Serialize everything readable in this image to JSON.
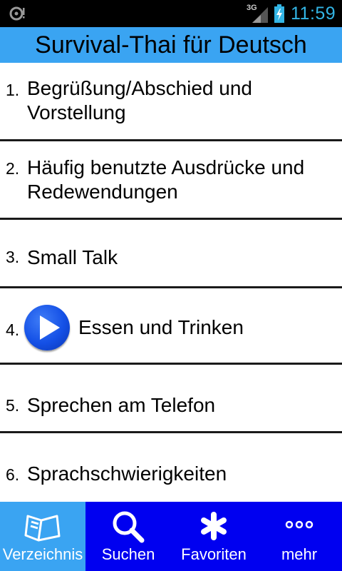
{
  "status_bar": {
    "network": "3G",
    "time": "11:59",
    "accent_color": "#33b5e5"
  },
  "app": {
    "title": "Survival-Thai für Deutsch",
    "title_bar_color": "#3aa4f2"
  },
  "list": {
    "items": [
      {
        "number": "1.",
        "label_line1": "Begrüßung/Abschied und",
        "label_line2": "Vorstellung"
      },
      {
        "number": "2.",
        "label_line1": "Häufig benutzte Ausdrücke und",
        "label_line2": "Redewendungen"
      },
      {
        "number": "3.",
        "label_line1": "Small Talk"
      },
      {
        "number": "4.",
        "label_line1": "Essen und Trinken",
        "icon": "play-icon"
      },
      {
        "number": "5.",
        "label_line1": "Sprechen am Telefon"
      },
      {
        "number": "6.",
        "label_line1": "Sprachschwierigkeiten"
      }
    ]
  },
  "tabs": [
    {
      "label": "Verzeichnis",
      "icon": "book-icon",
      "active": true
    },
    {
      "label": "Suchen",
      "icon": "search-icon",
      "active": false
    },
    {
      "label": "Favoriten",
      "icon": "asterisk-icon",
      "active": false
    },
    {
      "label": "mehr",
      "icon": "more-icon",
      "active": false
    }
  ],
  "tab_bar_color": "#0000f0"
}
